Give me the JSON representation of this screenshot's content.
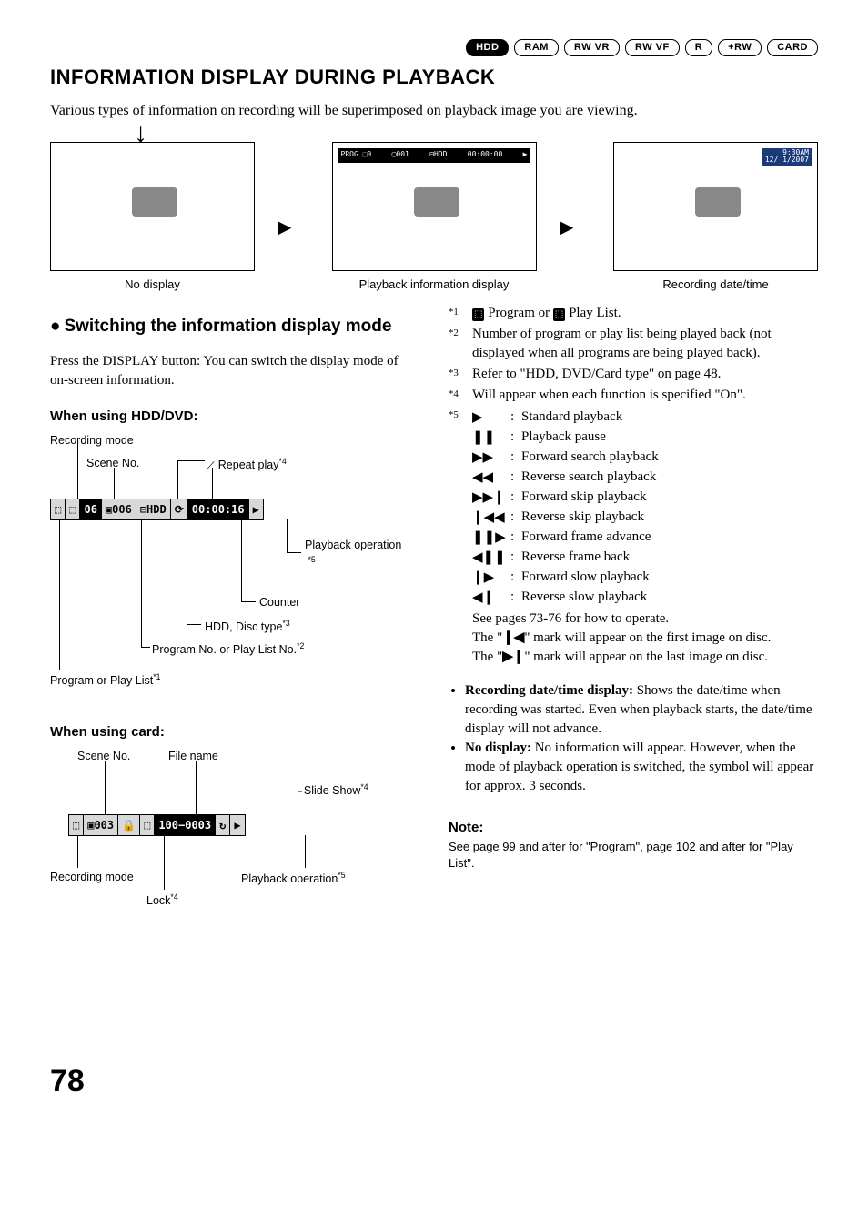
{
  "badges": [
    "HDD",
    "RAM",
    "RW VR",
    "RW VF",
    "R",
    "+RW",
    "CARD"
  ],
  "title": "INFORMATION DISPLAY DURING PLAYBACK",
  "intro": "Various types of information on recording will be superimposed on playback image you are viewing.",
  "fig": {
    "left": "No display",
    "mid": "Playback information display",
    "right": "Recording date/time",
    "osd_mid": {
      "a": "PROG ⬚0",
      "b": "▢001",
      "c": "⊟HDD",
      "d": "00:00:00",
      "e": "▶"
    },
    "dt1": "9:30AM",
    "dt2": "12/ 1/2007"
  },
  "left": {
    "h2": "Switching the information display mode",
    "p1": "Press the DISPLAY button: You can switch the display mode of on-screen information.",
    "h3a": "When using HDD/DVD:",
    "dd": {
      "recmode": "Recording mode",
      "scene": "Scene No.",
      "repeat": "Repeat play",
      "repeat_sup": "*4",
      "osd": {
        "c1": "⬚",
        "c2": "⬚",
        "c3": "06",
        "c4": "▣006",
        "c5": "⊟HDD",
        "c6": "⟳",
        "c7": "00:00:16",
        "c8": "▶"
      },
      "pbop": "Playback operation",
      "pbop_sup": "*5",
      "counter": "Counter",
      "disc": "HDD, Disc type",
      "disc_sup": "*3",
      "progno": "Program No. or Play List No.",
      "progno_sup": "*2",
      "progor": "Program or Play List",
      "progor_sup": "*1"
    },
    "h3b": "When using card:",
    "cd": {
      "scene": "Scene No.",
      "fname": "File name",
      "slide": "Slide Show",
      "slide_sup": "*4",
      "osd": {
        "c1": "⬚",
        "c2": "▣003",
        "c3": "🔒",
        "c4": "⬚",
        "c5": "100−0003",
        "c6": "↻",
        "c7": "▶"
      },
      "recmode": "Recording mode",
      "pbop": "Playback operation",
      "pbop_sup": "*5",
      "lock": "Lock",
      "lock_sup": "*4"
    }
  },
  "right": {
    "refs": [
      {
        "n": "*1",
        "t_pre": "",
        "t": " Program or ",
        "t2": " Play List."
      },
      {
        "n": "*2",
        "t": "Number of program or play list being played back (not displayed when all programs are being played back)."
      },
      {
        "n": "*3",
        "t": "Refer to \"HDD, DVD/Card type\" on page 48."
      },
      {
        "n": "*4",
        "t": "Will appear when each function is specified \"On\"."
      }
    ],
    "n5": "*5",
    "syms": [
      {
        "s": "▶",
        "t": "Standard playback"
      },
      {
        "s": "❚❚",
        "t": "Playback pause"
      },
      {
        "s": "▶▶",
        "t": "Forward search playback"
      },
      {
        "s": "◀◀",
        "t": "Reverse search playback"
      },
      {
        "s": "▶▶❙",
        "t": "Forward skip playback"
      },
      {
        "s": "❙◀◀",
        "t": "Reverse skip playback"
      },
      {
        "s": "❚❚▶",
        "t": "Forward frame advance"
      },
      {
        "s": "◀❚❚",
        "t": "Reverse frame back"
      },
      {
        "s": "❙▶",
        "t": "Forward slow playback"
      },
      {
        "s": "◀❙",
        "t": "Reverse slow playback"
      }
    ],
    "after_syms1": "See pages 73-76 for how to operate.",
    "after_syms2a": "The \"",
    "after_syms2b": "\" mark will appear on the first image on disc.",
    "after_syms3a": "The \"",
    "after_syms3b": "\" mark will appear on the last image on disc.",
    "mark_first": "❙◀",
    "mark_last": "▶❙",
    "bul1_h": "Recording date/time display:",
    "bul1_t": " Shows the date/time when recording was started. Even when playback starts, the date/time display will not advance.",
    "bul2_h": "No display:",
    "bul2_t": " No information will appear. However, when the mode of playback operation is switched, the symbol will appear for approx. 3 seconds.",
    "note_h": "Note:",
    "note_b": "See page 99 and after for \"Program\", page 102 and after for \"Play List\"."
  },
  "pagenum": "78"
}
